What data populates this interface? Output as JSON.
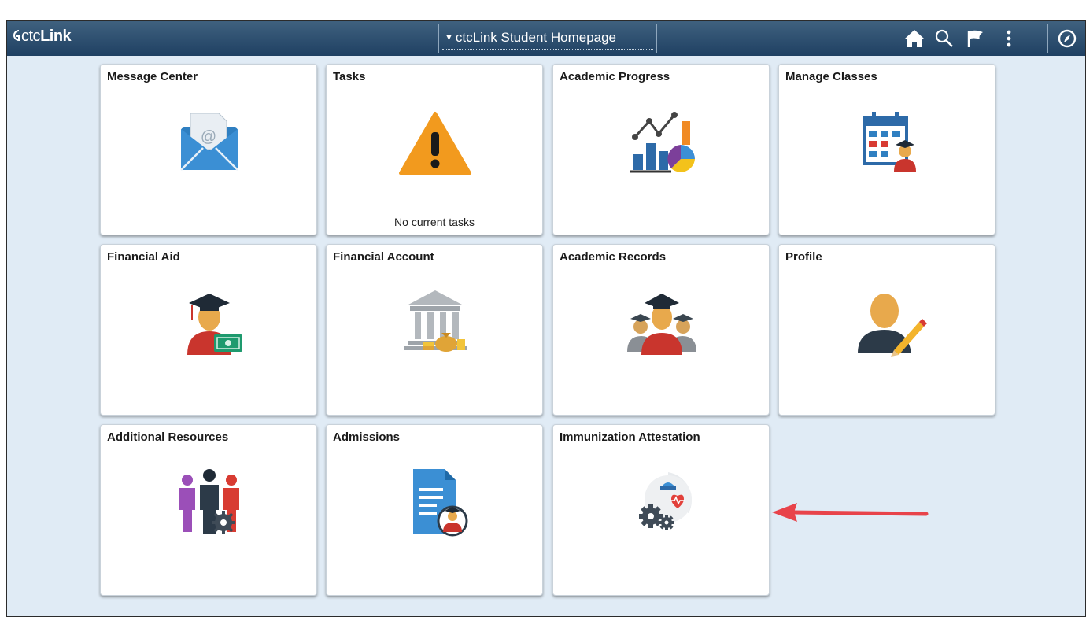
{
  "header": {
    "logo_prefix": "ctc",
    "logo_bold": "Link",
    "homepage_title": "ctcLink Student Homepage",
    "icons": [
      "home-icon",
      "search-icon",
      "flag-icon",
      "actions-menu-icon",
      "navbar-compass-icon"
    ]
  },
  "tiles": [
    {
      "title": "Message Center",
      "icon": "envelope-icon",
      "note": ""
    },
    {
      "title": "Tasks",
      "icon": "warning-icon",
      "note": "No current tasks"
    },
    {
      "title": "Academic Progress",
      "icon": "charts-icon",
      "note": ""
    },
    {
      "title": "Manage Classes",
      "icon": "calendar-student-icon",
      "note": ""
    },
    {
      "title": "Financial Aid",
      "icon": "graduate-money-icon",
      "note": ""
    },
    {
      "title": "Financial Account",
      "icon": "bank-icon",
      "note": ""
    },
    {
      "title": "Academic Records",
      "icon": "graduates-group-icon",
      "note": ""
    },
    {
      "title": "Profile",
      "icon": "profile-edit-icon",
      "note": ""
    },
    {
      "title": "Additional Resources",
      "icon": "people-gear-icon",
      "note": ""
    },
    {
      "title": "Admissions",
      "icon": "document-student-icon",
      "note": ""
    },
    {
      "title": "Immunization Attestation",
      "icon": "health-gears-icon",
      "note": ""
    }
  ],
  "colors": {
    "banner_top": "#3f617f",
    "banner_bottom": "#1f4062",
    "page_bg": "#e0ebf5",
    "annotation_arrow": "#e8434a"
  }
}
